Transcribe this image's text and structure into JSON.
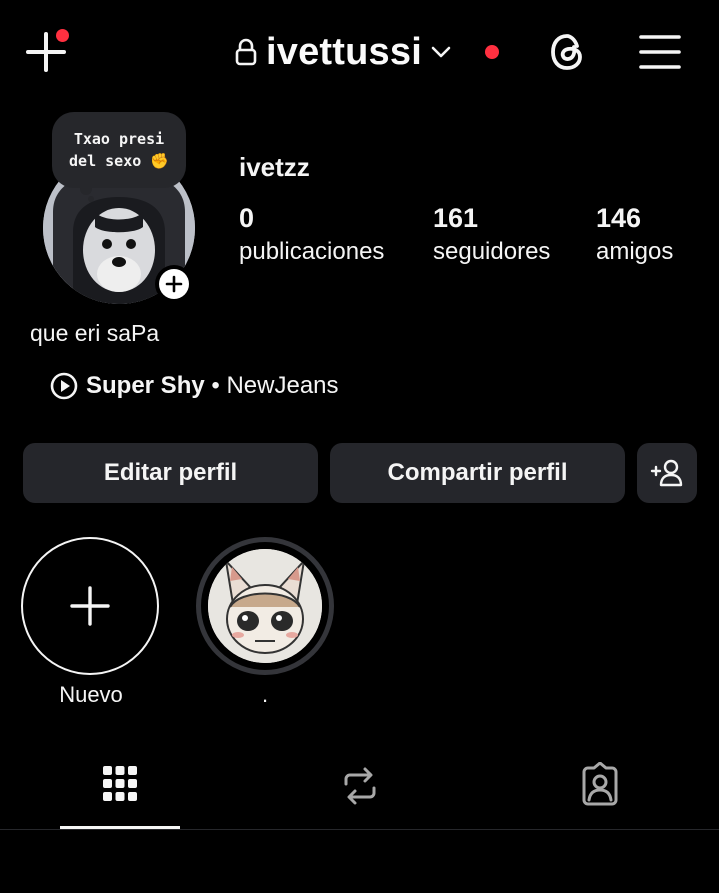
{
  "header": {
    "username": "ivettussi",
    "icons": {
      "create": "plus-icon",
      "lock": "lock-icon",
      "dropdown": "chevron-down-icon",
      "threads": "threads-icon",
      "menu": "hamburger-menu-icon"
    },
    "notification_color": "#ff3040"
  },
  "profile": {
    "note_line1": "Txao presi",
    "note_line2": "del sexo ✊",
    "display_name": "ivetzz",
    "stats": [
      {
        "value": "0",
        "label": "publicaciones"
      },
      {
        "value": "161",
        "label": "seguidores"
      },
      {
        "value": "146",
        "label": "amigos"
      }
    ],
    "bio": "que eri saPa",
    "music": {
      "song": "Super Shy",
      "separator": " • ",
      "artist": "NewJeans"
    }
  },
  "actions": {
    "edit_label": "Editar perfil",
    "share_label": "Compartir perfil",
    "suggest_icon": "add-person-icon"
  },
  "highlights": [
    {
      "label": "Nuevo"
    },
    {
      "label": "."
    }
  ],
  "tabs": [
    {
      "icon": "grid-icon",
      "active": true
    },
    {
      "icon": "reposts-icon",
      "active": false
    },
    {
      "icon": "tagged-icon",
      "active": false
    }
  ],
  "colors": {
    "background": "#000000",
    "button_bg": "#25262b",
    "text": "#f5f5f5"
  }
}
